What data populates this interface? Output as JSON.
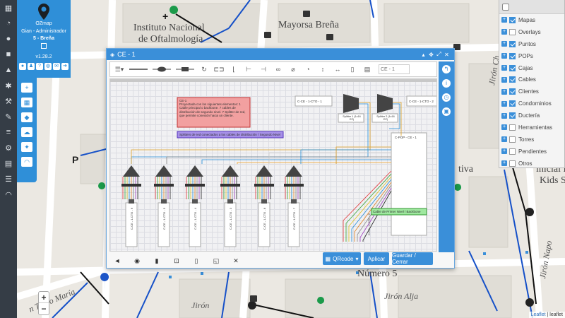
{
  "map": {
    "labels": {
      "instituto": "Instituto Nacional",
      "oftalmologia": "de Oftalmología",
      "mayorsa": "Mayorsa Breña",
      "p": "P",
      "tiva": "tiva",
      "happy": "inicial Happy",
      "kids": "Kids Scho",
      "numero5": "Número 5",
      "jiron_alja": "Jirón Alja",
      "jiron_b": "Jirón",
      "tingo": "n Tingo María",
      "jiron_napo": "Jirón Napo",
      "jiron_ch": "Jirón Ch"
    },
    "zoom_in": "+",
    "zoom_out": "−",
    "attribution_link": "Leaflet",
    "attribution_rest": "| leaflet"
  },
  "user": {
    "brand": "OZmap",
    "role": "Gian - Administrador",
    "zone": "5 - Breña",
    "version": "v1.28.2"
  },
  "layers": [
    {
      "label": "Mapas",
      "checked": true
    },
    {
      "label": "Overlays",
      "checked": false
    },
    {
      "label": "Puntos",
      "checked": true
    },
    {
      "label": "POPs",
      "checked": true
    },
    {
      "label": "Cajas",
      "checked": true
    },
    {
      "label": "Cables",
      "checked": true
    },
    {
      "label": "Clientes",
      "checked": true
    },
    {
      "label": "Condominios",
      "checked": true
    },
    {
      "label": "Ductería",
      "checked": true
    },
    {
      "label": "Herramientas",
      "checked": false
    },
    {
      "label": "Torres",
      "checked": false
    },
    {
      "label": "Pendientes",
      "checked": false
    },
    {
      "label": "Otros",
      "checked": false
    }
  ],
  "dialog": {
    "title": "CE - 1",
    "search_placeholder": "CE - 1",
    "note_title": "CE-1",
    "note_body": "Proyectada con los siguientes elementos: 1 Cable principal o backbone. 7 cables de distribución de segundo nivel. 7 Splitter de red, que permite conexión hacia un cliente.",
    "purple_label": "Splitters de red conectados a los cables de distribución / Segundo Nivel",
    "green_label": "Cable de Primer Nivel / Backbone",
    "cto_top_left": "C-CE - 1-CTO - 1",
    "cto_top_right": "C-CE - 1-CTO - 2",
    "splitter_a": "Splitter 1 (1x16 EZ)",
    "splitter_b": "Splitter 2 (1x16 EZ)",
    "pop_label": "C-POP - CE - 1",
    "cable_labels": [
      "C-CE - 1-CTO - 6",
      "C-CE - 1-CTO - 5",
      "C-CE - 1-CTO - 4",
      "C-CE - 1-CTO - 3",
      "C-CE - 1-CTO - 8",
      "C-CE - 1-CTO - 7"
    ],
    "main_cable_label": "C-CE - 1-CTO - 9",
    "qr_button": "QRcode",
    "apply_button": "Aplicar",
    "save_button": "Guardar / Cerrar"
  }
}
